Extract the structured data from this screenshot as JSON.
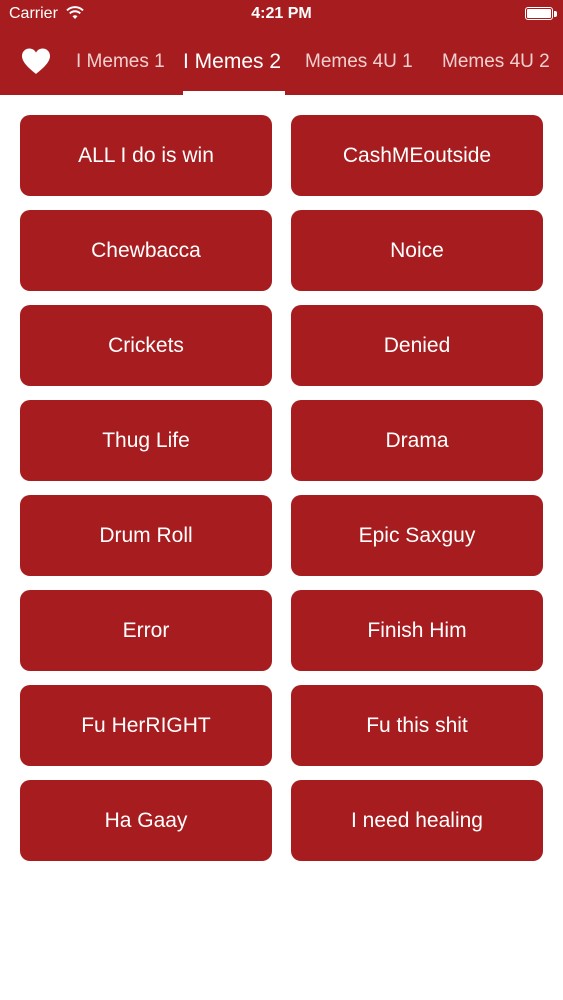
{
  "status": {
    "carrier": "Carrier",
    "time": "4:21 PM"
  },
  "icons": {
    "wifi": "wifi-icon",
    "battery": "battery-icon",
    "favorites": "heart-icon"
  },
  "colors": {
    "brand": "#a71d1f",
    "text": "#ffffff"
  },
  "tabs": [
    {
      "label": "I Memes 1"
    },
    {
      "label": "I Memes 2"
    },
    {
      "label": "Memes 4U 1"
    },
    {
      "label": "Memes 4U 2"
    }
  ],
  "active_tab": "I Memes 2",
  "sounds": [
    {
      "label": "ALL I do is win"
    },
    {
      "label": "CashMEoutside"
    },
    {
      "label": "Chewbacca"
    },
    {
      "label": "Noice"
    },
    {
      "label": "Crickets"
    },
    {
      "label": "Denied"
    },
    {
      "label": "Thug Life"
    },
    {
      "label": "Drama"
    },
    {
      "label": "Drum Roll"
    },
    {
      "label": "Epic Saxguy"
    },
    {
      "label": "Error"
    },
    {
      "label": "Finish Him"
    },
    {
      "label": "Fu HerRIGHT"
    },
    {
      "label": "Fu this shit"
    },
    {
      "label": "Ha Gaay"
    },
    {
      "label": "I need healing"
    }
  ]
}
